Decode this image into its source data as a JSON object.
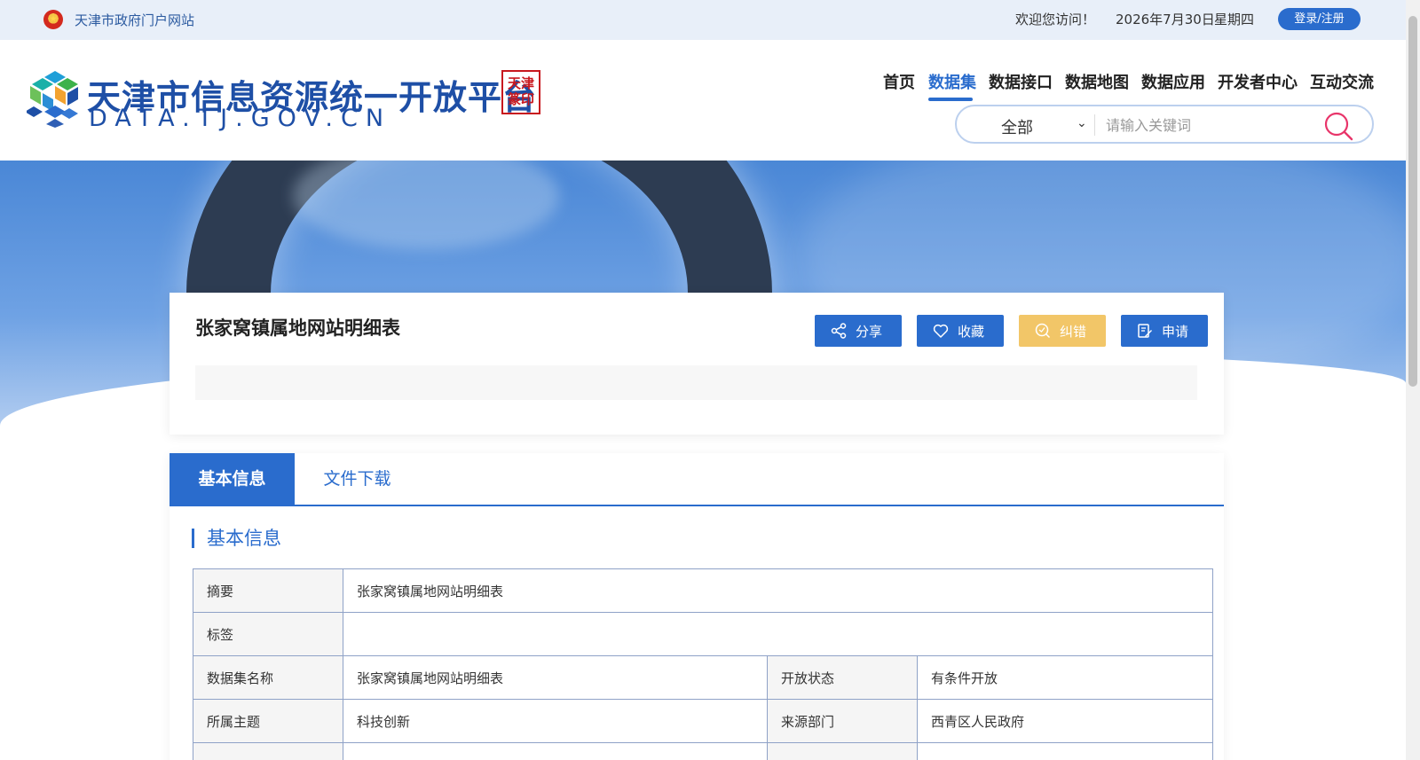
{
  "topbar": {
    "portal_link": "天津市政府门户网站",
    "welcome": "欢迎您访问！",
    "date": "2026年7月30日",
    "weekday": "星期四",
    "login": "登录/注册"
  },
  "header": {
    "logo_title": "天津市信息资源统一开放平台",
    "logo_sub": "DATA.TJ.GOV.CN",
    "seal_text": "天津 TIANJIN·CHINA",
    "nav": [
      "首页",
      "数据集",
      "数据接口",
      "数据地图",
      "数据应用",
      "开发者中心",
      "互动交流"
    ],
    "active_nav": "数据集",
    "search": {
      "select_value": "全部",
      "placeholder": "请输入关键词"
    }
  },
  "dataset": {
    "title": "张家窝镇属地网站明细表",
    "actions": {
      "share": "分享",
      "favorite": "收藏",
      "correct": "纠错",
      "apply": "申请"
    },
    "description": ""
  },
  "tabs": {
    "basic": "基本信息",
    "download": "文件下载"
  },
  "section_title": "基本信息",
  "info": {
    "summary_label": "摘要",
    "summary_value": "张家窝镇属地网站明细表",
    "tags_label": "标签",
    "tags_value": "",
    "name_label": "数据集名称",
    "name_value": "张家窝镇属地网站明细表",
    "open_label": "开放状态",
    "open_value": "有条件开放",
    "topic_label": "所属主题",
    "topic_value": "科技创新",
    "source_label": "来源部门",
    "source_value": "西青区人民政府"
  },
  "colors": {
    "primary": "#2a6ccd",
    "warning": "#f2c668",
    "topbar_bg": "#e8eff9",
    "table_border": "#8fa2c7"
  }
}
